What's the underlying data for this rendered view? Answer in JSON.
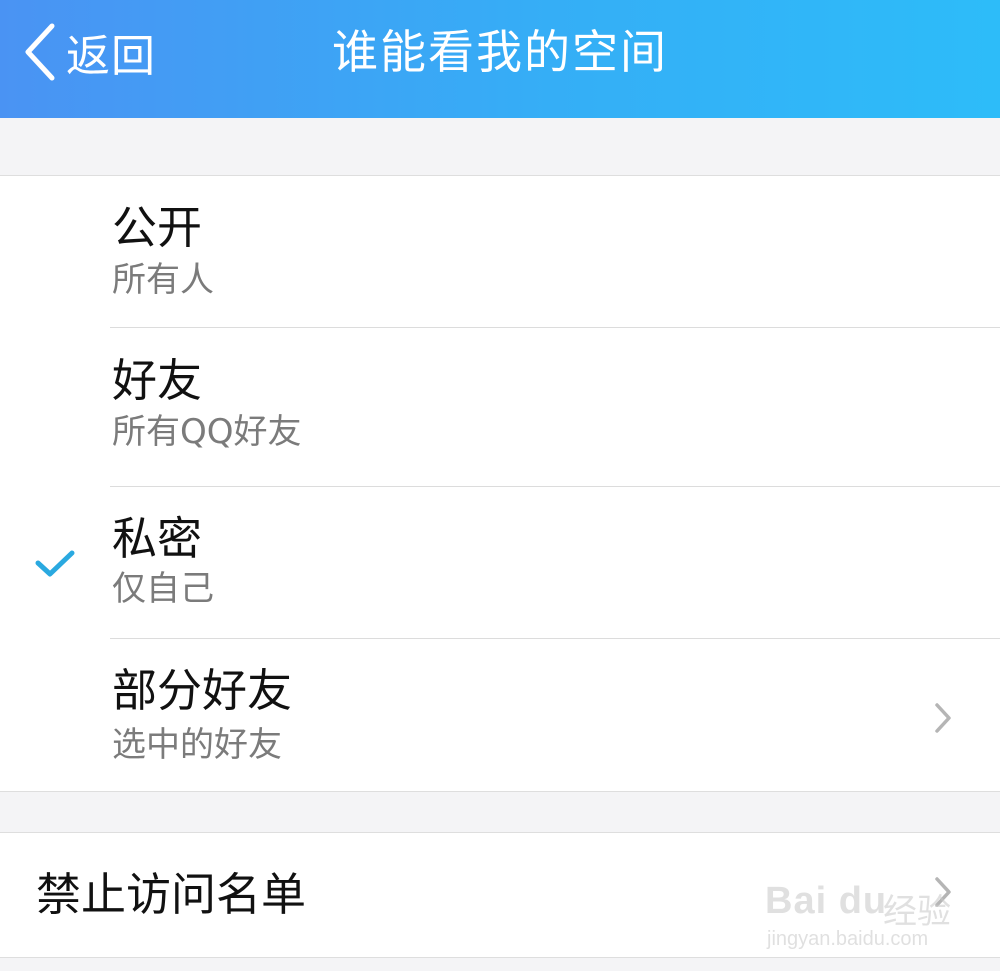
{
  "header": {
    "back_label": "返回",
    "title": "谁能看我的空间"
  },
  "options": [
    {
      "title": "公开",
      "subtitle": "所有人",
      "selected": false
    },
    {
      "title": "好友",
      "subtitle": "所有QQ好友",
      "selected": false
    },
    {
      "title": "私密",
      "subtitle": "仅自己",
      "selected": true
    },
    {
      "title": "部分好友",
      "subtitle": "选中的好友",
      "selected": false
    }
  ],
  "blocked_list": {
    "label": "禁止访问名单"
  },
  "watermark": {
    "logo": "Bai du",
    "logo_cn": "经验",
    "url": "jingyan.baidu.com"
  },
  "colors": {
    "header_start": "#4a93f3",
    "header_end": "#2dbcf9",
    "check": "#2aa9e0"
  }
}
